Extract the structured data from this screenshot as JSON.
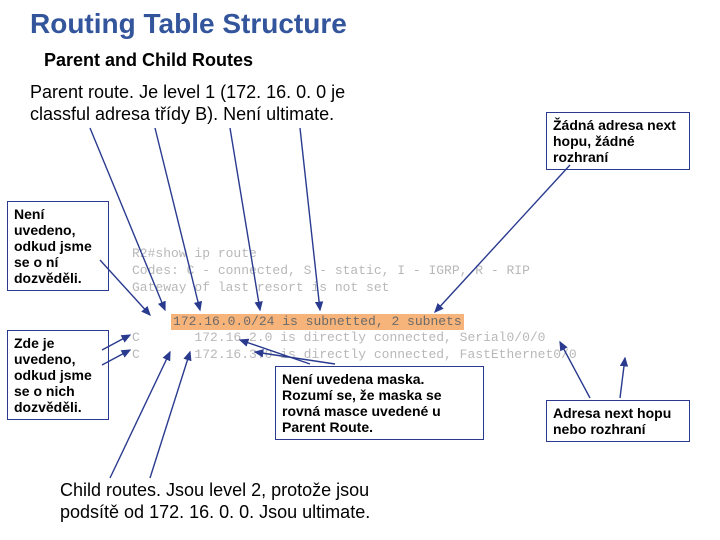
{
  "title": "Routing Table Structure",
  "subtitle": "Parent and Child Routes",
  "parent_desc": "Parent route. Je level 1 (172. 16. 0. 0 je classful adresa třídy B). Není ultimate.",
  "child_desc": "Child routes. Jsou level 2, protože jsou podsítě od 172. 16. 0. 0. Jsou ultimate.",
  "callouts": {
    "no_source": "Není uvedeno, odkud jsme se o ní dozvěděli.",
    "has_source": "Zde je uvedeno, odkud jsme se o nich dozvěděli.",
    "no_nexthop": "Žádná adresa next hopu, žádné rozhraní",
    "no_mask": "Není uvedena maska. Rozumí se, že maska se rovná masce uvedené u Parent Route.",
    "nexthop_or_if": "Adresa next hopu nebo rozhraní"
  },
  "router": {
    "prompt": "R2#",
    "cmd": "show ip route",
    "codes": "Codes: C - connected, S - static, I - IGRP, R - RIP",
    "gateway": "Gateway of last resort is not set",
    "parent_hl": "172.16.0.0/24 is subnetted, 2 subnets",
    "c1_code": "C",
    "c1_rest": "       172.16.2.0 is directly connected, Serial0/0/0",
    "c2_code": "C",
    "c2_rest": "       172.16.3.0 is directly connected, FastEthernet0/0"
  }
}
